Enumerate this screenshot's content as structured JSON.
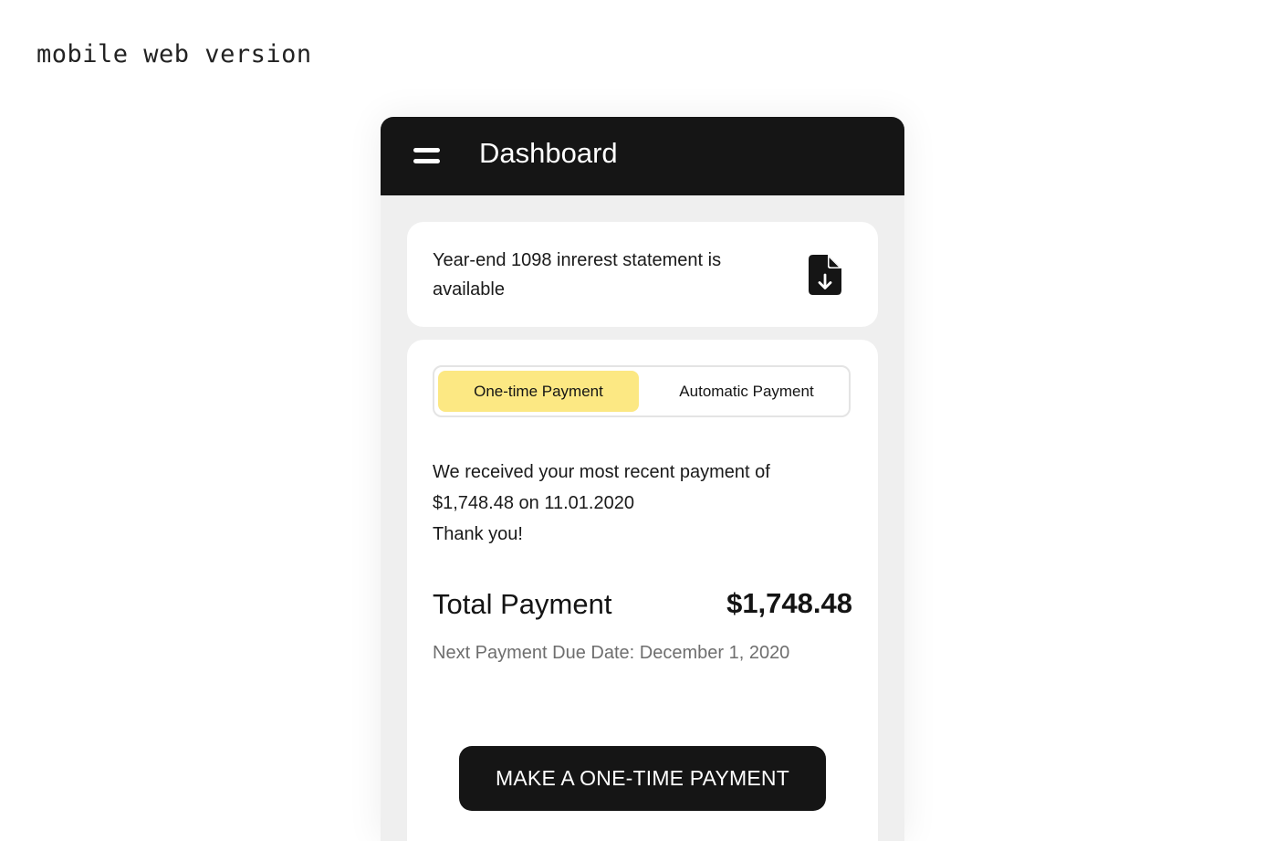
{
  "caption": "mobile web version",
  "appbar": {
    "title": "Dashboard",
    "menu_icon": "hamburger-menu-icon"
  },
  "notice": {
    "text": "Year-end 1098 inrerest statement is available",
    "icon": "document-download-icon"
  },
  "payment_tabs": {
    "active": "One-time Payment",
    "inactive": "Automatic Payment",
    "active_color": "#fce883"
  },
  "payment_info": {
    "received_line1": "We received your most recent payment of",
    "received_line2": "$1,748.48 on 11.01.2020",
    "thanks": "Thank you!",
    "total_label": "Total Payment",
    "total_amount": "$1,748.48",
    "due_date": "Next Payment Due Date: December 1, 2020"
  },
  "cta": {
    "label": "MAKE A ONE-TIME PAYMENT"
  },
  "colors": {
    "appbar": "#151515",
    "background": "#efefef",
    "accent": "#fce883"
  }
}
